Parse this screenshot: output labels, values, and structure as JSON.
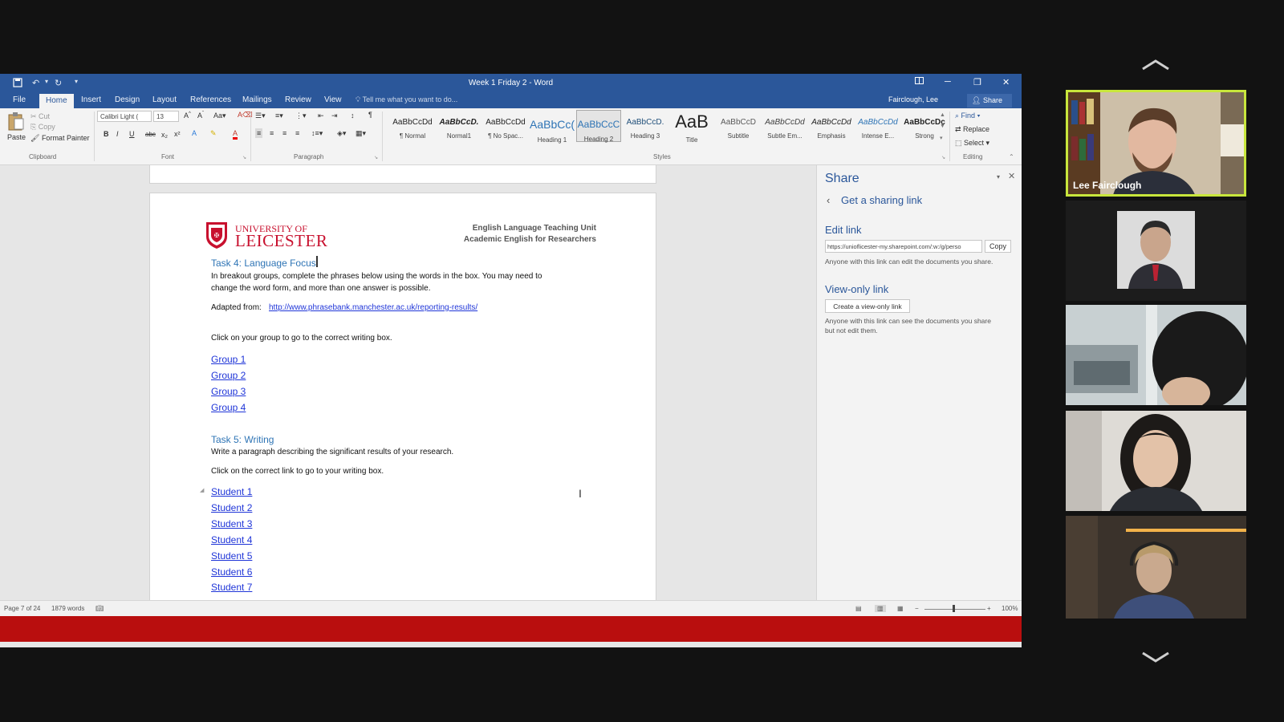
{
  "window": {
    "title": "Week 1 Friday 2 - Word"
  },
  "tabs": [
    "File",
    "Home",
    "Insert",
    "Design",
    "Layout",
    "References",
    "Mailings",
    "Review",
    "View"
  ],
  "tell_me": "Tell me what you want to do...",
  "user": "Fairclough, Lee",
  "share_button": "Share",
  "ribbon": {
    "clipboard": {
      "paste": "Paste",
      "cut": "Cut",
      "copy": "Copy",
      "format_painter": "Format Painter",
      "label": "Clipboard"
    },
    "font": {
      "name": "Calibri Light (",
      "size": "13",
      "label": "Font"
    },
    "paragraph": {
      "label": "Paragraph"
    },
    "styles": {
      "label": "Styles",
      "items": [
        {
          "preview": "AaBbCcDd",
          "name": "¶ Normal"
        },
        {
          "preview": "AaBbCcD.",
          "name": "Normal1"
        },
        {
          "preview": "AaBbCcDd",
          "name": "¶ No Spac..."
        },
        {
          "preview": "AaBbCc(",
          "name": "Heading 1"
        },
        {
          "preview": "AaBbCcC",
          "name": "Heading 2"
        },
        {
          "preview": "AaBbCcD.",
          "name": "Heading 3"
        },
        {
          "preview": "AaB",
          "name": "Title"
        },
        {
          "preview": "AaBbCcD",
          "name": "Subtitle"
        },
        {
          "preview": "AaBbCcDd",
          "name": "Subtle Em..."
        },
        {
          "preview": "AaBbCcDd",
          "name": "Emphasis"
        },
        {
          "preview": "AaBbCcDd",
          "name": "Intense E..."
        },
        {
          "preview": "AaBbCcDc",
          "name": "Strong"
        }
      ]
    },
    "editing": {
      "find": "Find",
      "replace": "Replace",
      "select": "Select",
      "label": "Editing"
    }
  },
  "document": {
    "logo_line1": "UNIVERSITY OF",
    "logo_line2": "LEICESTER",
    "header_line1": "English Language Teaching Unit",
    "header_line2": "Academic English for Researchers",
    "task4_heading": "Task 4: Language Focus",
    "task4_p1": "In breakout groups, complete the phrases below using the words in the box.  You may need to",
    "task4_p2": "change the word form, and more than one answer is possible.",
    "adapted_label": "Adapted from:",
    "adapted_link": "http://www.phrasebank.manchester.ac.uk/reporting-results/",
    "click_group": "Click on your group to go to the correct writing box.",
    "groups": [
      "Group 1",
      "Group 2",
      "Group 3",
      "Group 4"
    ],
    "task5_heading": "Task 5: Writing",
    "task5_p1": "Write a paragraph describing the significant results of your research.",
    "click_student": "Click on the correct link to go to your writing box.",
    "students": [
      "Student 1",
      "Student 2",
      "Student 3",
      "Student 4",
      "Student 5",
      "Student 6",
      "Student 7"
    ]
  },
  "share_pane": {
    "title": "Share",
    "back_link": "Get a sharing link",
    "edit_link_heading": "Edit link",
    "edit_link_url": "https://unioflicester-my.sharepoint.com/:w:/g/perso",
    "copy_button": "Copy",
    "edit_link_desc": "Anyone with this link can edit the documents you share.",
    "view_only_heading": "View-only link",
    "create_view_button": "Create a view-only link",
    "view_only_desc1": "Anyone with this link can see the documents you share",
    "view_only_desc2": "but not edit them."
  },
  "status": {
    "page": "Page 7 of 24",
    "words": "1879 words",
    "zoom": "100%"
  },
  "participants": {
    "active_speaker": "Lee Fairclough"
  },
  "colors": {
    "word_blue": "#2b579a",
    "active_border": "#c8e63c",
    "red_bar": "#b90e0e",
    "heading_blue": "#2e74b5",
    "link_blue": "#1f35d8"
  }
}
